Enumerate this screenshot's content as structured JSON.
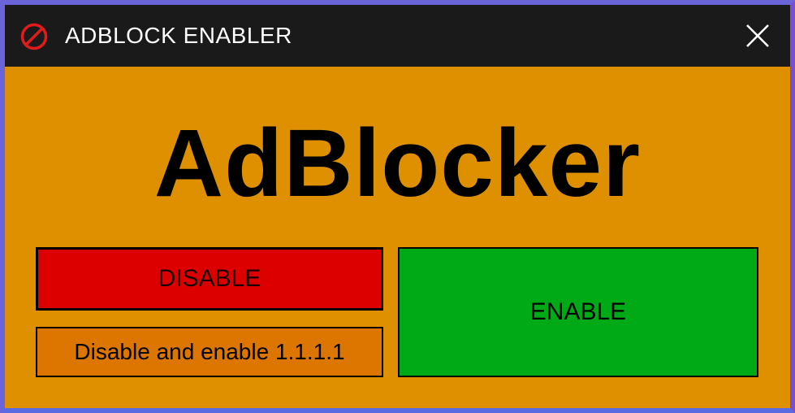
{
  "window": {
    "title": "ADBLOCK ENABLER",
    "icon": "no-entry-icon",
    "close_icon": "close-icon"
  },
  "main": {
    "heading": "AdBlocker",
    "buttons": {
      "disable_label": "DISABLE",
      "disable_enable_label": "Disable and enable 1.1.1.1",
      "enable_label": "ENABLE"
    }
  },
  "colors": {
    "background": "#de9000",
    "titlebar": "#1a1a1a",
    "disable": "#dd0000",
    "disable_enable": "#dc7600",
    "enable": "#00aa17"
  }
}
